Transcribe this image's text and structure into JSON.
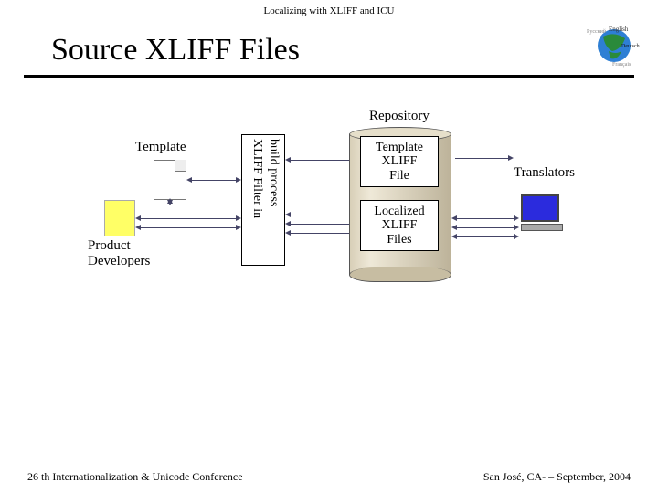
{
  "header_small": "Localizing with XLIFF and ICU",
  "title": "Source XLIFF Files",
  "globe_words": {
    "en": "English",
    "de": "Deutsch",
    "fr": "Français",
    "ru": "Русский"
  },
  "diagram": {
    "repository_label": "Repository",
    "template_label": "Template",
    "developers_label_line1": "Product",
    "developers_label_line2": "Developers",
    "filter_line1": "XLIFF Filter in",
    "filter_line2": "build process",
    "repo_top_line1": "Template",
    "repo_top_line2": "XLIFF",
    "repo_top_line3": "File",
    "repo_bottom_line1": "Localized",
    "repo_bottom_line2": "XLIFF",
    "repo_bottom_line3": "Files",
    "translators_label": "Translators"
  },
  "footer_left": "26 th Internationalization & Unicode Conference",
  "footer_right": "San José, CA- – September, 2004"
}
